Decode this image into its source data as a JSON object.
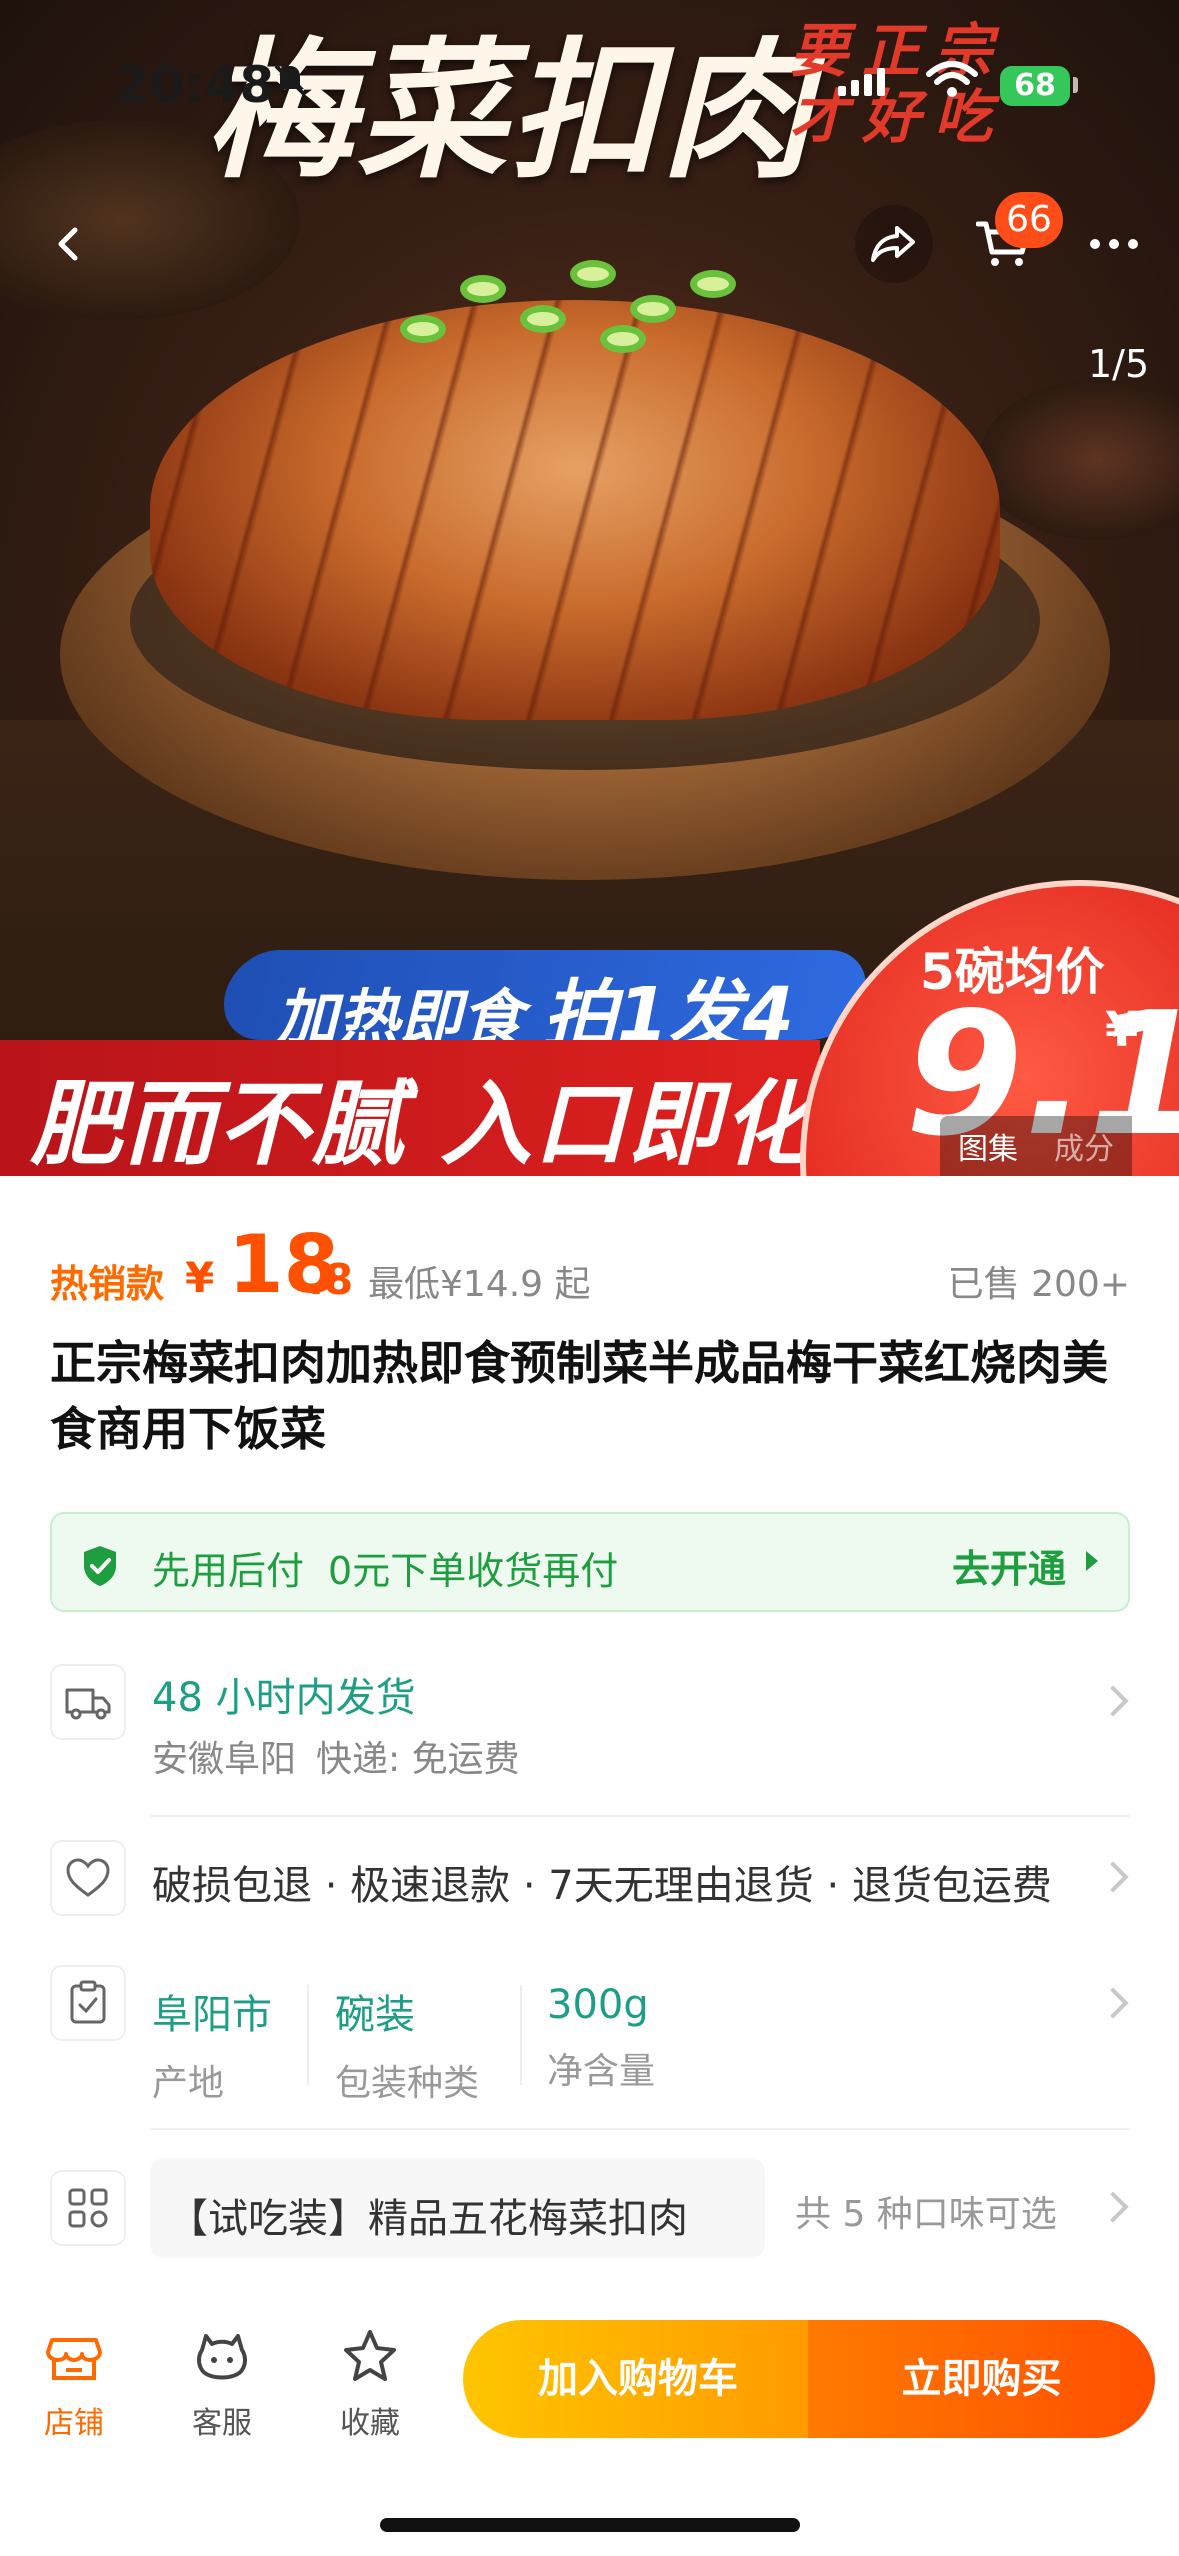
{
  "status_bar": {
    "time": "20:48",
    "battery": "68"
  },
  "hero": {
    "title": "梅菜扣肉",
    "slogan": "要正宗才好吃",
    "banner_blue_a": "加热即食",
    "banner_blue_b": "拍1发4",
    "banner_red": "肥而不腻 入口即化",
    "badge_label": "5碗均价",
    "badge_value": "9.1",
    "badge_currency": "¥",
    "gallery_tabs": [
      "图集",
      "成分"
    ],
    "page_indicator": "1/5"
  },
  "top_bar": {
    "cart_count": "66"
  },
  "price": {
    "hot_tag": "热销款",
    "currency": "¥",
    "integer": "18",
    "decimal": ".8",
    "min_price": "最低¥14.9 起",
    "sold": "已售 200+"
  },
  "product_title": "正宗梅菜扣肉加热即食预制菜半成品梅干菜红烧肉美食商用下饭菜",
  "pay_later": {
    "label": "先用后付",
    "desc": "0元下单收货再付",
    "cta": "去开通",
    "accent": "#1f9e3f"
  },
  "shipping": {
    "main": "48 小时内发货",
    "origin": "安徽阜阳",
    "express": "快递: 免运费"
  },
  "guarantee": "破损包退 · 极速退款 · 7天无理由退货 · 退货包运费",
  "specs": [
    {
      "value": "阜阳市",
      "label": "产地"
    },
    {
      "value": "碗装",
      "label": "包装种类"
    },
    {
      "value": "300g",
      "label": "净含量"
    }
  ],
  "variant": {
    "selected": "【试吃装】精品五花梅菜扣肉",
    "count": "共 5 种口味可选"
  },
  "bottom_bar": {
    "tabs": [
      "店铺",
      "客服",
      "收藏"
    ],
    "add_to_cart": "加入购物车",
    "buy_now": "立即购买",
    "brand_color": "#ff5000"
  }
}
